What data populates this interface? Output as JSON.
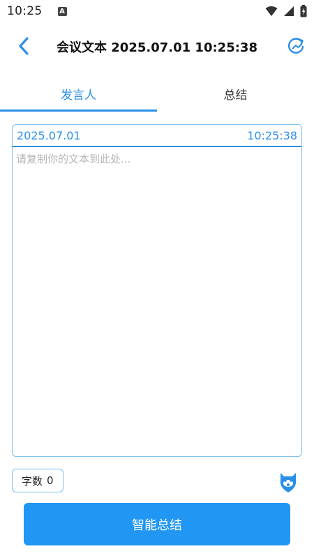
{
  "status_bar": {
    "time": "10:25",
    "notification_badge": "A"
  },
  "header": {
    "title": "会议文本 2025.07.01 10:25:38"
  },
  "tabs": [
    {
      "label": "发言人",
      "active": true
    },
    {
      "label": "总结",
      "active": false
    }
  ],
  "editor": {
    "date": "2025.07.01",
    "time": "10:25:38",
    "placeholder": "请复制你的文本到此处...",
    "value": ""
  },
  "word_count": {
    "label": "字数",
    "value": "0"
  },
  "actions": {
    "summary_label": "智能总结"
  },
  "colors": {
    "accent": "#2b8fe8",
    "button": "#2196f3",
    "border": "#7cc0f0"
  }
}
